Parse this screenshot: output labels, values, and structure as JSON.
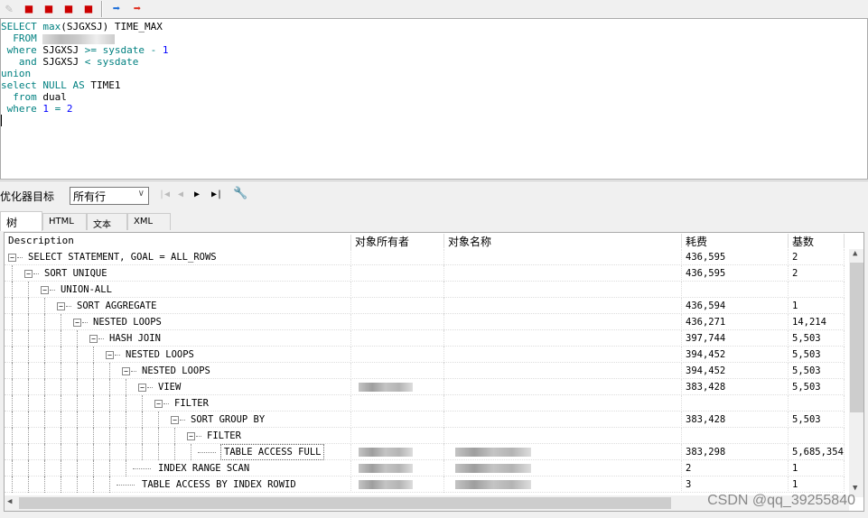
{
  "toolbar": {
    "icons": [
      "eraser-icon",
      "db-icon",
      "db-folder-icon",
      "db-lock-icon",
      "db-brush-icon",
      "arrow-right-blue-icon",
      "arrow-right-red-icon"
    ]
  },
  "editor": {
    "lines": [
      [
        [
          "kw",
          "SELECT "
        ],
        [
          "kw",
          "max"
        ],
        [
          "",
          "(SJGXSJ) TIME_MAX"
        ]
      ],
      [
        [
          "kw",
          "  FROM "
        ],
        [
          "",
          ""
        ]
      ],
      [
        [
          "kw",
          " where "
        ],
        [
          "",
          "SJGXSJ "
        ],
        [
          "kw",
          ">= sysdate - "
        ],
        [
          "nm",
          "1"
        ]
      ],
      [
        [
          "kw",
          "   and "
        ],
        [
          "",
          "SJGXSJ "
        ],
        [
          "kw",
          "< sysdate"
        ]
      ],
      [
        [
          "kw",
          "union"
        ]
      ],
      [
        [
          "kw",
          "select "
        ],
        [
          "kw",
          "NULL AS "
        ],
        [
          "",
          "TIME1"
        ]
      ],
      [
        [
          "kw",
          "  from "
        ],
        [
          "",
          "dual"
        ]
      ],
      [
        [
          "kw",
          " where "
        ],
        [
          "nm",
          "1"
        ],
        [
          "kw",
          " = "
        ],
        [
          "nm",
          "2"
        ]
      ]
    ]
  },
  "optimizer": {
    "label": "优化器目标",
    "selected": "所有行"
  },
  "tabs": [
    {
      "label": "树",
      "active": true
    },
    {
      "label": "HTML"
    },
    {
      "label": "文本"
    },
    {
      "label": "XML"
    }
  ],
  "grid": {
    "headers": [
      "Description",
      "对象所有者",
      "对象名称",
      "耗费",
      "基数"
    ],
    "rows": [
      {
        "level": 0,
        "desc": "SELECT STATEMENT, GOAL = ALL_ROWS",
        "cost": "436,595",
        "card": "2",
        "expandable": true
      },
      {
        "level": 1,
        "desc": "SORT UNIQUE",
        "cost": "436,595",
        "card": "2",
        "expandable": true
      },
      {
        "level": 2,
        "desc": "UNION-ALL",
        "cost": "",
        "card": "",
        "expandable": true
      },
      {
        "level": 3,
        "desc": "SORT AGGREGATE",
        "cost": "436,594",
        "card": "1",
        "expandable": true
      },
      {
        "level": 4,
        "desc": "NESTED LOOPS",
        "cost": "436,271",
        "card": "14,214",
        "expandable": true
      },
      {
        "level": 5,
        "desc": "HASH JOIN",
        "cost": "397,744",
        "card": "5,503",
        "expandable": true
      },
      {
        "level": 6,
        "desc": "NESTED LOOPS",
        "cost": "394,452",
        "card": "5,503",
        "expandable": true
      },
      {
        "level": 7,
        "desc": "NESTED LOOPS",
        "cost": "394,452",
        "card": "5,503",
        "expandable": true
      },
      {
        "level": 8,
        "desc": "VIEW",
        "cost": "383,428",
        "card": "5,503",
        "expandable": true,
        "owner_blur": true
      },
      {
        "level": 9,
        "desc": "FILTER",
        "cost": "",
        "card": "",
        "expandable": true
      },
      {
        "level": 10,
        "desc": "SORT GROUP BY",
        "cost": "383,428",
        "card": "5,503",
        "expandable": true
      },
      {
        "level": 11,
        "desc": "FILTER",
        "cost": "",
        "card": "",
        "expandable": true
      },
      {
        "level": 12,
        "desc": "TABLE ACCESS FULL",
        "cost": "383,298",
        "card": "5,685,354",
        "expandable": false,
        "owner_blur": true,
        "name_blur": true,
        "selected": true
      },
      {
        "level": 8,
        "desc": "INDEX RANGE SCAN",
        "cost": "2",
        "card": "1",
        "expandable": false,
        "owner_blur": true,
        "name_blur": true
      },
      {
        "level": 7,
        "desc": "TABLE ACCESS BY INDEX ROWID",
        "cost": "3",
        "card": "1",
        "expandable": false,
        "owner_blur": true,
        "name_blur": true
      }
    ]
  },
  "watermark": "CSDN @qq_39255840"
}
